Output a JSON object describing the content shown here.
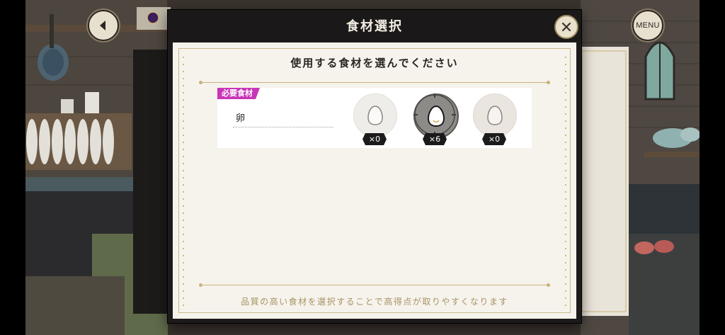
{
  "header": {
    "back_icon": "back-arrow-icon",
    "menu_label": "MENU"
  },
  "dialog": {
    "title": "食材選択",
    "instruction": "使用する食材を選んでください",
    "required_badge": "必要食材",
    "ingredient_name": "卵",
    "options": [
      {
        "icon": "egg-icon",
        "count": "×0",
        "state": "unavailable"
      },
      {
        "icon": "egg-icon",
        "count": "×6",
        "state": "selected"
      },
      {
        "icon": "egg-icon",
        "count": "×0",
        "state": "unavailable"
      }
    ],
    "footer_hint": "品質の高い食材を選択することで高得点が取りやすくなります"
  },
  "colors": {
    "badge": "#c735b8",
    "gold": "#c8b27a",
    "paper": "#f6f3ed",
    "dialog_bg": "#1c1a1a"
  }
}
